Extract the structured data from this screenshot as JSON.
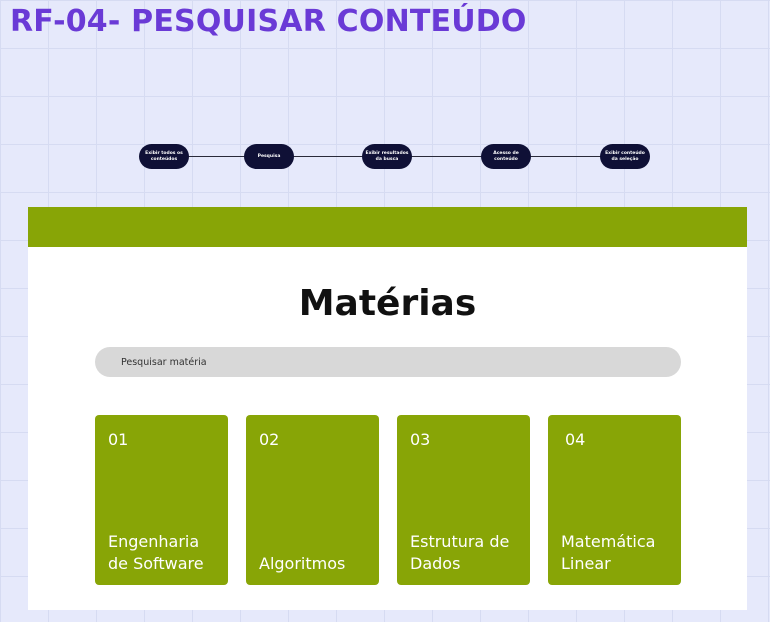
{
  "board": {
    "title": "RF-04- PESQUISAR CONTEÚDO"
  },
  "flow": {
    "nodes": [
      {
        "label": "Exibir todos os conteúdos"
      },
      {
        "label": "Pesquisa"
      },
      {
        "label": "Exibir resultados da busca"
      },
      {
        "label": "Acesso de conteúdo"
      },
      {
        "label": "Exibir conteúdo da seleção"
      }
    ]
  },
  "page": {
    "title": "Matérias",
    "search": {
      "value": "",
      "placeholder": "Pesquisar matéria"
    },
    "cards": [
      {
        "number": "01",
        "name": "Engenharia de Software"
      },
      {
        "number": "02",
        "name": "Algoritmos"
      },
      {
        "number": "03",
        "name": "Estrutura de Dados"
      },
      {
        "number": "04",
        "name": "Matemática Linear"
      }
    ]
  },
  "colors": {
    "board_background": "#e6e9fb",
    "title": "#6a3ad6",
    "flow_node": "#0f1036",
    "accent_green": "#88a506",
    "search_bg": "#d8d8d8"
  }
}
